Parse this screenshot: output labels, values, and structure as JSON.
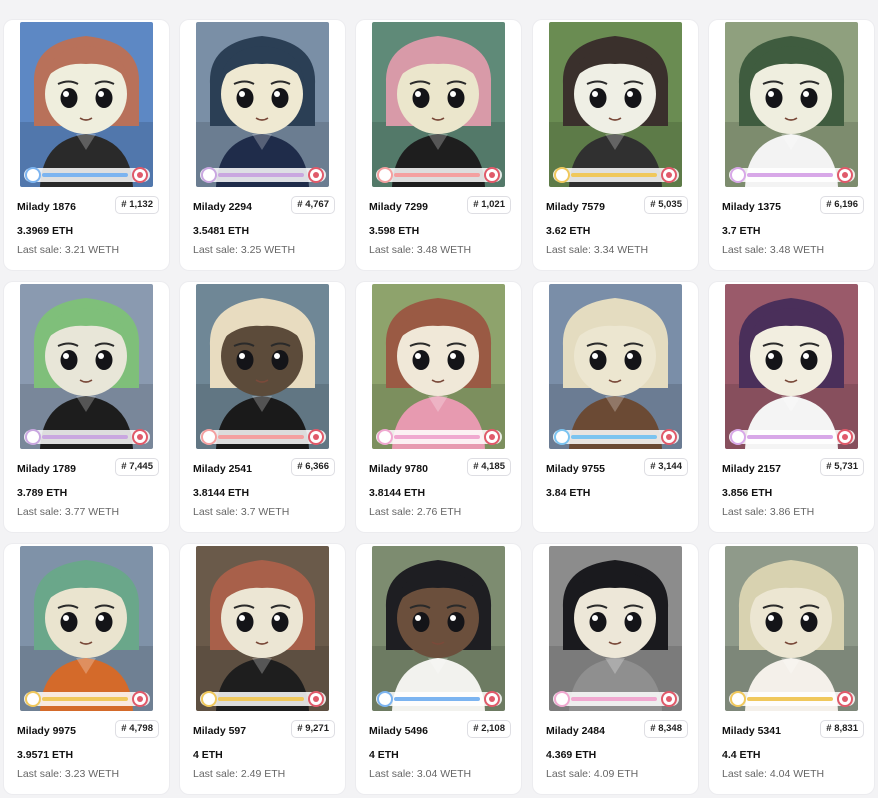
{
  "labels": {
    "last_sale_prefix": "Last sale: "
  },
  "items": [
    {
      "name": "Milady 1876",
      "rank": "# 1,132",
      "price": "3.3969 ETH",
      "last_sale": "Last sale: 3.21 WETH",
      "bg": "#5d88c4",
      "hair": "#b8715a",
      "skin": "#efeedd",
      "shirt": "#2a2a2a",
      "badge": "R",
      "accent": "#7cb4f0"
    },
    {
      "name": "Milady 2294",
      "rank": "# 4,767",
      "price": "3.5481 ETH",
      "last_sale": "Last sale: 3.25 WETH",
      "bg": "#7a8fa6",
      "hair": "#2b3f55",
      "skin": "#efe9d2",
      "shirt": "#1f2c4a",
      "badge": "",
      "accent": "#c9a7e0"
    },
    {
      "name": "Milady 7299",
      "rank": "# 1,021",
      "price": "3.598 ETH",
      "last_sale": "Last sale: 3.48 WETH",
      "bg": "#5f8a78",
      "hair": "#d89aa8",
      "skin": "#ebe6cc",
      "shirt": "#1e1e1e",
      "badge": "S",
      "accent": "#f4a0a0"
    },
    {
      "name": "Milady 7579",
      "rank": "# 5,035",
      "price": "3.62 ETH",
      "last_sale": "Last sale: 3.34 WETH",
      "bg": "#6a8c52",
      "hair": "#3a302c",
      "skin": "#efefe5",
      "shirt": "#303030",
      "badge": "C",
      "accent": "#f0c85c"
    },
    {
      "name": "Milady 1375",
      "rank": "# 6,196",
      "price": "3.7 ETH",
      "last_sale": "Last sale: 3.48 WETH",
      "bg": "#8fa07e",
      "hair": "#3f5c3f",
      "skin": "#efeedf",
      "shirt": "#f3f3f3",
      "badge": "",
      "accent": "#d8a8e8"
    },
    {
      "name": "Milady 1789",
      "rank": "# 7,445",
      "price": "3.789 ETH",
      "last_sale": "Last sale: 3.77 WETH",
      "bg": "#8a9ab0",
      "hair": "#7fbf7a",
      "skin": "#e8e6d8",
      "shirt": "#1d1d1d",
      "badge": "",
      "accent": "#c9a7e0"
    },
    {
      "name": "Milady 2541",
      "rank": "# 6,366",
      "price": "3.8144 ETH",
      "last_sale": "Last sale: 3.7 WETH",
      "bg": "#6f8796",
      "hair": "#e8dcc0",
      "skin": "#5c4b3a",
      "shirt": "#1a1a1a",
      "badge": "C",
      "accent": "#f4a0a0"
    },
    {
      "name": "Milady 9780",
      "rank": "# 4,185",
      "price": "3.8144 ETH",
      "last_sale": "Last sale: 2.76 ETH",
      "bg": "#8ea36c",
      "hair": "#9a5a44",
      "skin": "#f0e8d8",
      "shirt": "#e79ab0",
      "badge": "",
      "accent": "#f0a8d0"
    },
    {
      "name": "Milady 9755",
      "rank": "# 3,144",
      "price": "3.84 ETH",
      "last_sale": "",
      "bg": "#7a8ea8",
      "hair": "#e4dcc0",
      "skin": "#ece6d0",
      "shirt": "#6b4a34",
      "badge": "C",
      "accent": "#7cc4f0"
    },
    {
      "name": "Milady 2157",
      "rank": "# 5,731",
      "price": "3.856 ETH",
      "last_sale": "Last sale: 3.86 ETH",
      "bg": "#9a5a6a",
      "hair": "#4a2f5a",
      "skin": "#f2eee0",
      "shirt": "#f4f4f4",
      "badge": "B",
      "accent": "#d8a8e8"
    },
    {
      "name": "Milady 9975",
      "rank": "# 4,798",
      "price": "3.9571 ETH",
      "last_sale": "Last sale: 3.23 WETH",
      "bg": "#7f92a8",
      "hair": "#6aa78a",
      "skin": "#eae4cf",
      "shirt": "#d46a2a",
      "badge": "",
      "accent": "#f0c85c"
    },
    {
      "name": "Milady 597",
      "rank": "# 9,271",
      "price": "4 ETH",
      "last_sale": "Last sale: 2.49 ETH",
      "bg": "#6a5a4a",
      "hair": "#a8604a",
      "skin": "#ece6d4",
      "shirt": "#1e1e1e",
      "badge": "",
      "accent": "#f0c85c"
    },
    {
      "name": "Milady 5496",
      "rank": "# 2,108",
      "price": "4 ETH",
      "last_sale": "Last sale: 3.04 WETH",
      "bg": "#7d8c70",
      "hair": "#1e1e22",
      "skin": "#6b4f3c",
      "shirt": "#f2f2ee",
      "badge": "B",
      "accent": "#7cb4f0"
    },
    {
      "name": "Milady 2484",
      "rank": "# 8,348",
      "price": "4.369 ETH",
      "last_sale": "Last sale: 4.09 ETH",
      "bg": "#8c8c8c",
      "hair": "#1a1a1e",
      "skin": "#ede7d8",
      "shirt": "#8f8f8f",
      "badge": "C",
      "accent": "#f0a8d0"
    },
    {
      "name": "Milady 5341",
      "rank": "# 8,831",
      "price": "4.4 ETH",
      "last_sale": "Last sale: 4.04 WETH",
      "bg": "#8f9a8a",
      "hair": "#d8d2b0",
      "skin": "#ece6d2",
      "shirt": "#f4f0ea",
      "badge": "",
      "accent": "#f0c85c"
    }
  ]
}
